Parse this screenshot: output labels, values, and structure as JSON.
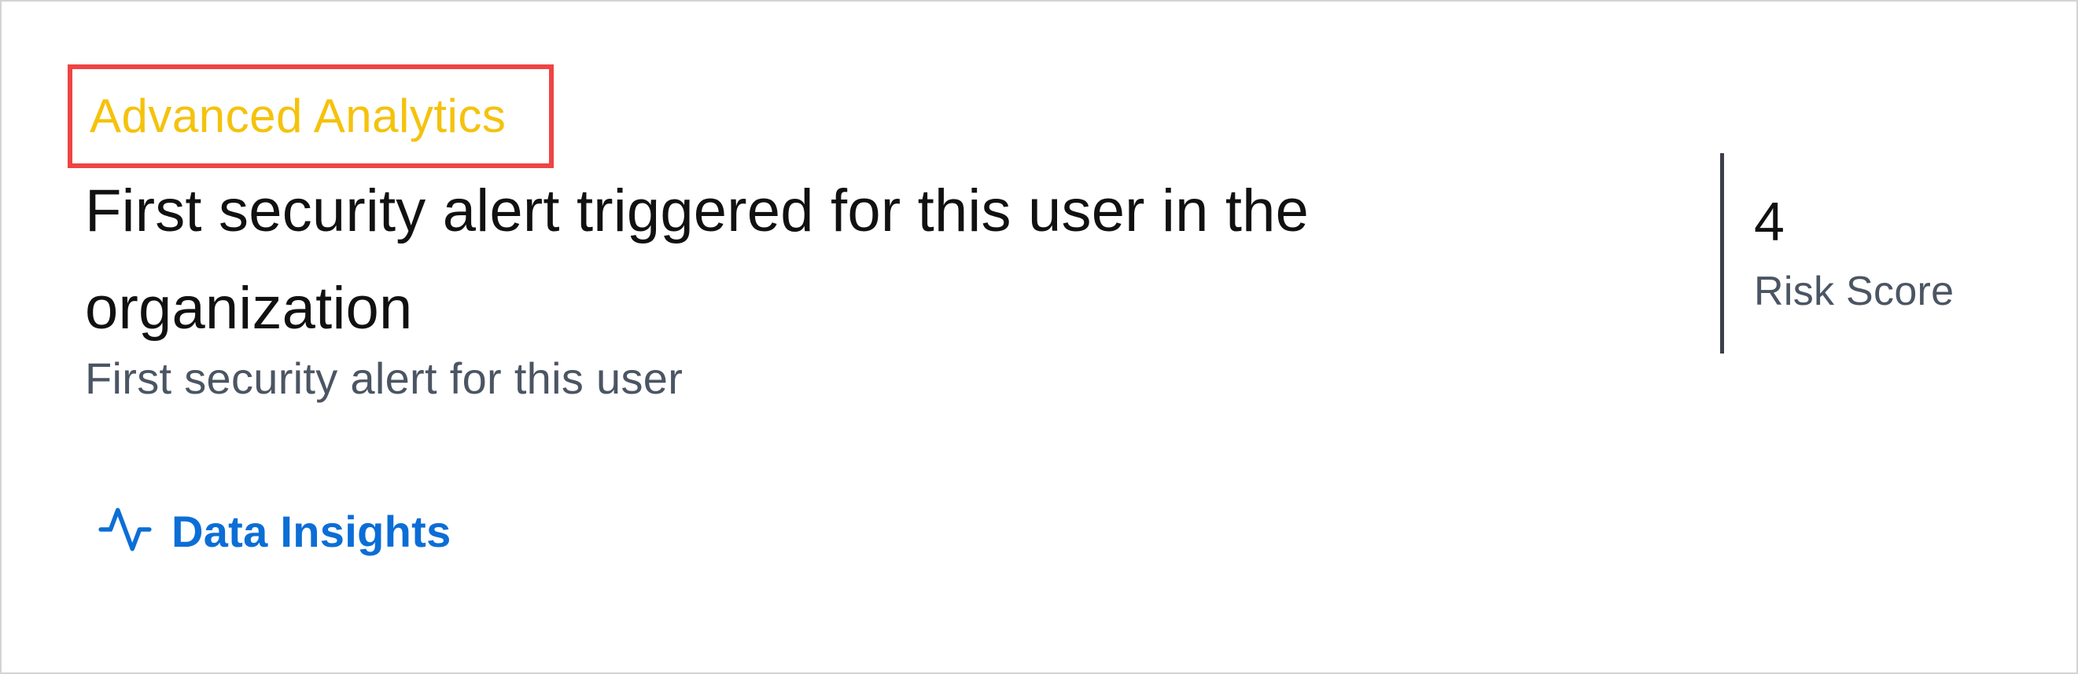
{
  "card": {
    "category": "Advanced Analytics",
    "title": "First security alert triggered for this user in the organization",
    "subtitle": "First security alert for this user",
    "insights_link": {
      "label": "Data Insights",
      "icon": "activity-icon"
    },
    "risk": {
      "value": "4",
      "label": "Risk Score"
    }
  },
  "colors": {
    "category": "#f5c20c",
    "highlight_border": "#ef4444",
    "link": "#0b6ed6",
    "muted_text": "#4b5563",
    "divider": "#3a3f4b"
  }
}
